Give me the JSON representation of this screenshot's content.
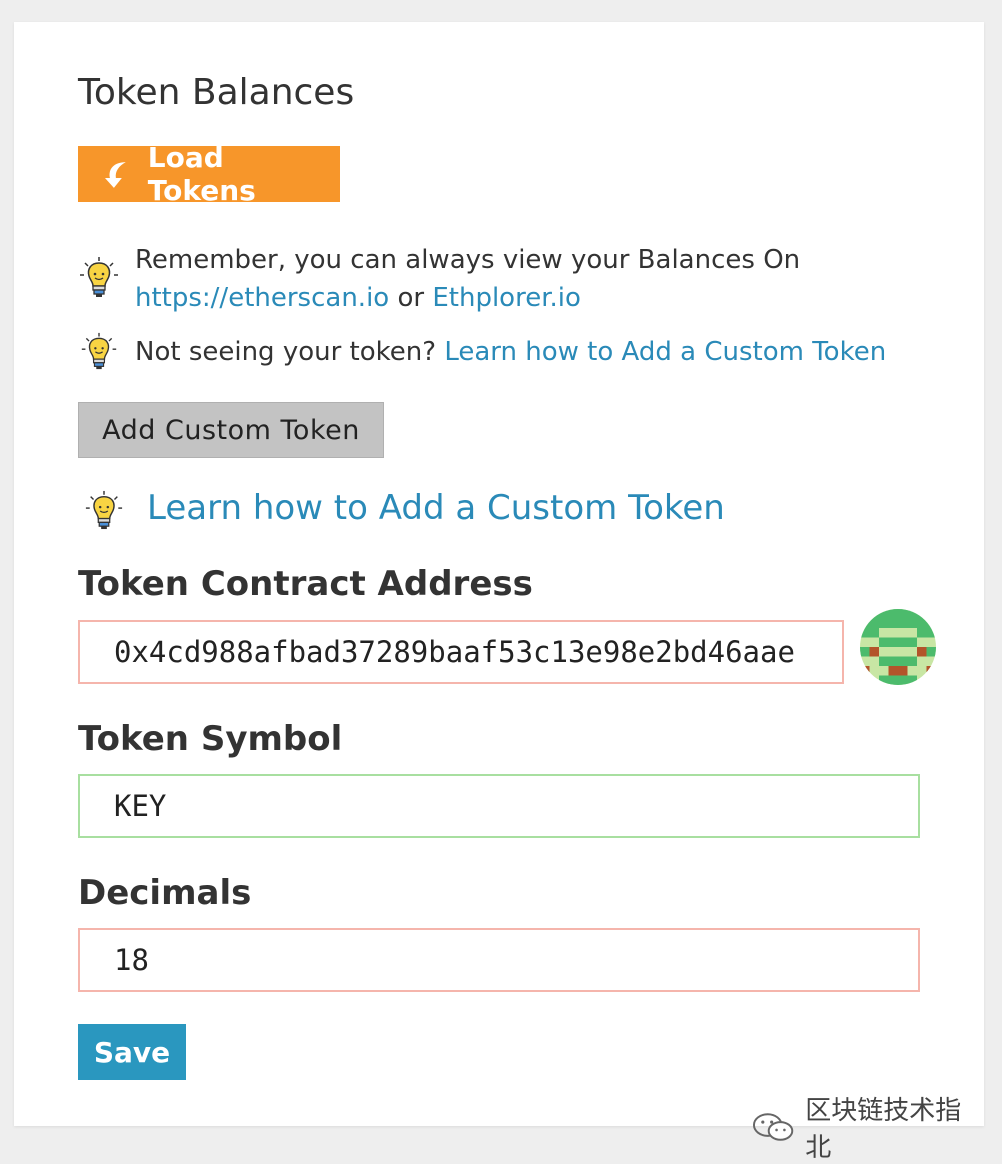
{
  "page": {
    "title": "Token Balances"
  },
  "load_button": {
    "label": "Load Tokens",
    "icon": "refresh-arrow-icon"
  },
  "tips": [
    {
      "icon": "lightbulb-icon",
      "text_before": "Remember, you can always view your Balances On",
      "link1": "https://etherscan.io",
      "middle": " or ",
      "link2": "Ethplorer.io"
    },
    {
      "icon": "lightbulb-icon",
      "text_before": "Not seeing your token? ",
      "link1": "Learn how to Add a Custom Token"
    }
  ],
  "custom_token_button": {
    "label": "Add Custom Token"
  },
  "help_link": {
    "icon": "lightbulb-icon",
    "label": "Learn how to Add a Custom Token"
  },
  "form": {
    "contract_address": {
      "label": "Token Contract Address",
      "value": "0x4cd988afbad37289baaf53c13e98e2bd46aae",
      "state": "invalid"
    },
    "symbol": {
      "label": "Token Symbol",
      "value": "KEY",
      "state": "valid"
    },
    "decimals": {
      "label": "Decimals",
      "value": "18",
      "state": "invalid"
    },
    "identicon": "address-identicon"
  },
  "save_button": {
    "label": "Save"
  },
  "watermark": {
    "icon": "wechat-icon",
    "text": "区块链技术指北"
  },
  "colors": {
    "load_button": "#f7962a",
    "save_button": "#2a97bf",
    "link": "#2a8ab8",
    "invalid_border": "#f5b5ac",
    "valid_border": "#a8dfa0",
    "custom_button": "#c3c3c3"
  }
}
